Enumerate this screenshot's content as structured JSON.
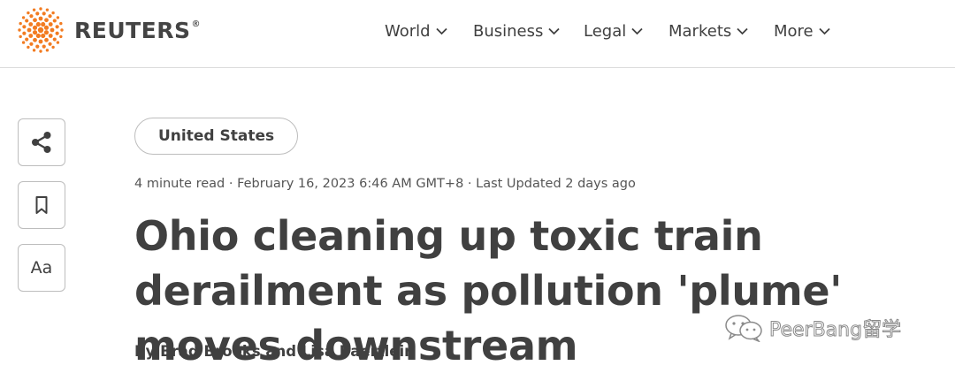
{
  "header": {
    "brand": "REUTERS",
    "brand_mark": "®",
    "nav": [
      {
        "label": "World"
      },
      {
        "label": "Business"
      },
      {
        "label": "Legal"
      },
      {
        "label": "Markets"
      },
      {
        "label": "More"
      }
    ]
  },
  "rail": {
    "share_icon": "share-icon",
    "bookmark_icon": "bookmark-icon",
    "text_size_label": "Aa"
  },
  "article": {
    "section_tag": "United States",
    "meta": "4 minute read · February 16, 2023 6:46 AM GMT+8 · Last Updated 2 days ago",
    "headline": "Ohio cleaning up toxic train derailment as pollution 'plume' moves downstream",
    "byline_prefix": "By ",
    "author_1": "Brad Brooks",
    "byline_joiner": " and ",
    "author_2": "Lisa Baertlein"
  },
  "watermark": {
    "text": "PeerBang留学"
  },
  "colors": {
    "brand_orange": "#f27b21",
    "text": "#404040",
    "border": "#bdbdbd"
  }
}
